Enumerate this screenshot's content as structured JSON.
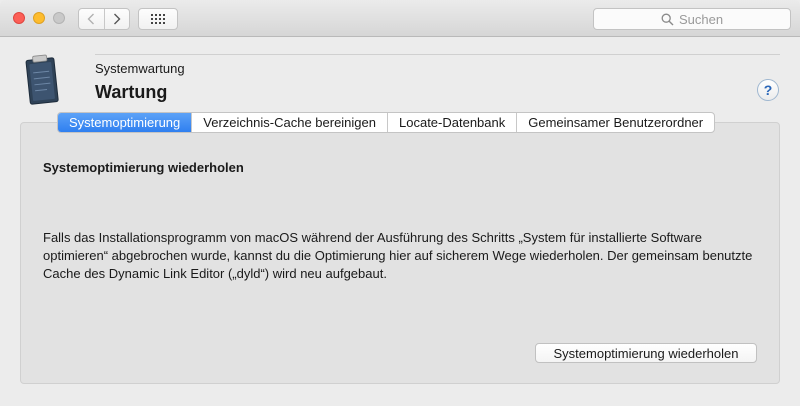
{
  "toolbar": {
    "back_icon": "chevron-left-icon",
    "forward_icon": "chevron-right-icon",
    "grid_icon": "grid-icon",
    "search_placeholder": "Suchen"
  },
  "header": {
    "subtitle": "Systemwartung",
    "title": "Wartung",
    "help_label": "?"
  },
  "tabs": [
    {
      "label": "Systemoptimierung",
      "active": true
    },
    {
      "label": "Verzeichnis-Cache bereinigen",
      "active": false
    },
    {
      "label": "Locate-Datenbank",
      "active": false
    },
    {
      "label": "Gemeinsamer Benutzerordner",
      "active": false
    }
  ],
  "content": {
    "section_title": "Systemoptimierung wiederholen",
    "description": "Falls das Installationsprogramm von macOS während der Ausführung des Schritts „System für installierte Software optimieren“ abgebrochen wurde, kannst du die Optimierung hier auf sicherem Wege wiederholen. Der gemeinsam benutzte Cache des Dynamic Link Editor („dyld“) wird neu aufgebaut.",
    "action_button": "Systemoptimierung wiederholen"
  },
  "colors": {
    "accent": "#2f7ff0",
    "close": "#fc5f57",
    "minimize": "#fdbc2e"
  }
}
